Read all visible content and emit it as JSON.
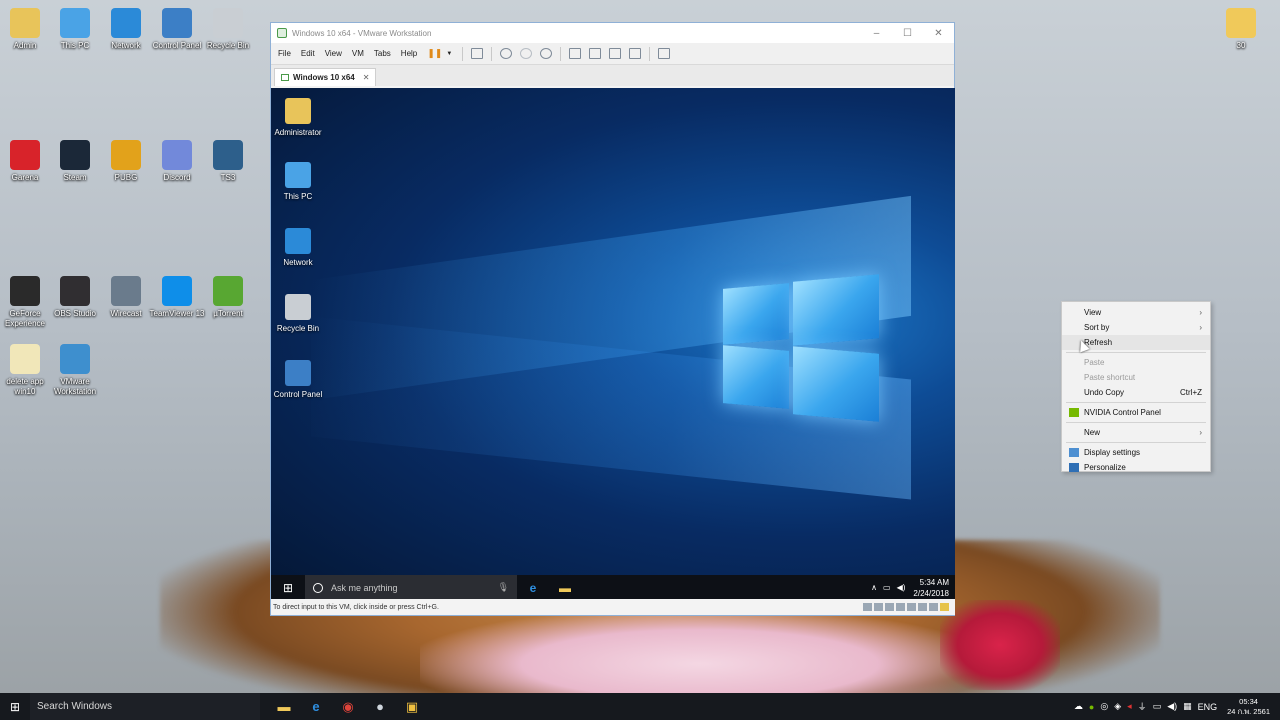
{
  "desktop": {
    "icons": [
      {
        "label": "Admin",
        "icon": "user-folder-icon",
        "color": "#e8c45a"
      },
      {
        "label": "This PC",
        "icon": "computer-icon",
        "color": "#4aa3e6"
      },
      {
        "label": "Network",
        "icon": "network-icon",
        "color": "#2b8ad8"
      },
      {
        "label": "Control Panel",
        "icon": "control-panel-icon",
        "color": "#3c7fc6"
      },
      {
        "label": "Recycle Bin",
        "icon": "recycle-bin-icon",
        "color": "#c9ced3"
      },
      {
        "label": "Garena",
        "icon": "garena-icon",
        "color": "#d8232a"
      },
      {
        "label": "Steam",
        "icon": "steam-icon",
        "color": "#1b2838"
      },
      {
        "label": "PUBG",
        "icon": "pubg-icon",
        "color": "#e2a21b"
      },
      {
        "label": "Discord",
        "icon": "discord-icon",
        "color": "#7289da"
      },
      {
        "label": "TS3",
        "icon": "teamspeak-icon",
        "color": "#2d5f8b"
      },
      {
        "label": "GeForce Experience",
        "icon": "geforce-icon",
        "color": "#2a2a2a"
      },
      {
        "label": "OBS Studio",
        "icon": "obs-icon",
        "color": "#302e31"
      },
      {
        "label": "Wirecast",
        "icon": "wirecast-icon",
        "color": "#6a7b8c"
      },
      {
        "label": "TeamViewer 13",
        "icon": "teamviewer-icon",
        "color": "#0e8ee9"
      },
      {
        "label": "µTorrent",
        "icon": "utorrent-icon",
        "color": "#58a732"
      },
      {
        "label": "delete app win10",
        "icon": "file-icon",
        "color": "#f1e7b9"
      },
      {
        "label": "VMware Workstation",
        "icon": "vmware-icon",
        "color": "#3e8fce"
      },
      {
        "label": "30",
        "icon": "folder-icon",
        "color": "#f0c95a"
      }
    ]
  },
  "vmware": {
    "title": "Windows 10 x64 - VMware Workstation",
    "menu": [
      "File",
      "Edit",
      "View",
      "VM",
      "Tabs",
      "Help"
    ],
    "tab_label": "Windows 10 x64",
    "status_text": "To direct input to this VM, click inside or press Ctrl+G.",
    "guest": {
      "icons": [
        {
          "label": "Administrator",
          "color": "#e8c45a"
        },
        {
          "label": "This PC",
          "color": "#4aa3e6"
        },
        {
          "label": "Network",
          "color": "#2b8ad8"
        },
        {
          "label": "Recycle Bin",
          "color": "#c9ced3"
        },
        {
          "label": "Control Panel",
          "color": "#3c7fc6"
        }
      ],
      "search_placeholder": "Ask me anything",
      "time": "5:34 AM",
      "date": "2/24/2018"
    }
  },
  "context_menu": {
    "items": [
      {
        "label": "View",
        "submenu": true
      },
      {
        "label": "Sort by",
        "submenu": true
      },
      {
        "label": "Refresh"
      },
      {
        "label": "Paste",
        "disabled": true
      },
      {
        "label": "Paste shortcut",
        "disabled": true
      },
      {
        "label": "Undo Copy",
        "shortcut": "Ctrl+Z"
      },
      {
        "label": "NVIDIA Control Panel"
      },
      {
        "label": "New",
        "submenu": true
      },
      {
        "label": "Display settings"
      },
      {
        "label": "Personalize"
      }
    ]
  },
  "taskbar": {
    "search_text": "Search Windows",
    "language": "ENG",
    "time": "05:34",
    "date": "24 ก.พ. 2561"
  }
}
